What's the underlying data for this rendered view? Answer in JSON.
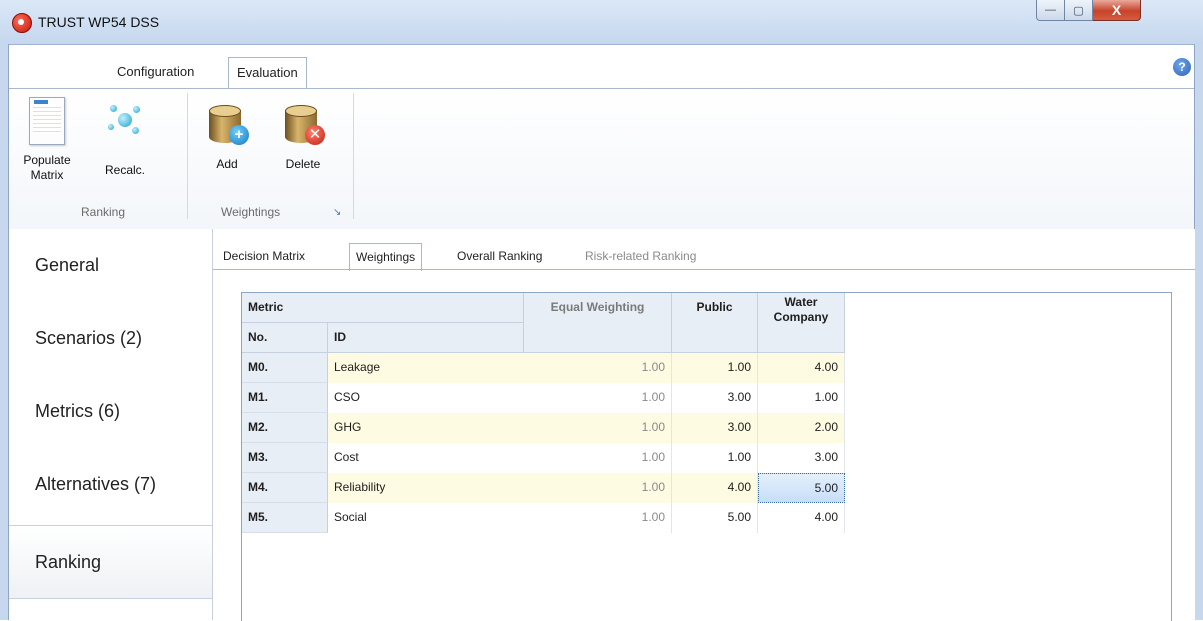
{
  "window": {
    "title": "TRUST WP54 DSS",
    "min": "—",
    "max": "▢",
    "close": "X"
  },
  "ribbon": {
    "tabs": {
      "configuration": "Configuration",
      "evaluation": "Evaluation"
    },
    "help": "?",
    "ranking_group": {
      "label": "Ranking",
      "populate_1": "Populate",
      "populate_2": "Matrix",
      "recalc": "Recalc."
    },
    "weightings_group": {
      "label": "Weightings",
      "add": "Add",
      "delete": "Delete",
      "launcher": "↘"
    }
  },
  "nav": {
    "general": "General",
    "scenarios": "Scenarios (2)",
    "metrics": "Metrics (6)",
    "alternatives": "Alternatives (7)",
    "ranking": "Ranking"
  },
  "content_tabs": {
    "decision_matrix": "Decision Matrix",
    "weightings": "Weightings",
    "overall_ranking": "Overall Ranking",
    "risk_ranking": "Risk-related Ranking"
  },
  "table": {
    "metric": "Metric",
    "no": "No.",
    "id": "ID",
    "equal": "Equal Weighting",
    "public": "Public",
    "water_1": "Water",
    "water_2": "Company",
    "rows": [
      {
        "no": "M0.",
        "id": "Leakage",
        "equal": "1.00",
        "public": "1.00",
        "water": "4.00"
      },
      {
        "no": "M1.",
        "id": "CSO",
        "equal": "1.00",
        "public": "3.00",
        "water": "1.00"
      },
      {
        "no": "M2.",
        "id": "GHG",
        "equal": "1.00",
        "public": "3.00",
        "water": "2.00"
      },
      {
        "no": "M3.",
        "id": "Cost",
        "equal": "1.00",
        "public": "1.00",
        "water": "3.00"
      },
      {
        "no": "M4.",
        "id": "Reliability",
        "equal": "1.00",
        "public": "4.00",
        "water": "5.00"
      },
      {
        "no": "M5.",
        "id": "Social",
        "equal": "1.00",
        "public": "5.00",
        "water": "4.00"
      }
    ]
  }
}
